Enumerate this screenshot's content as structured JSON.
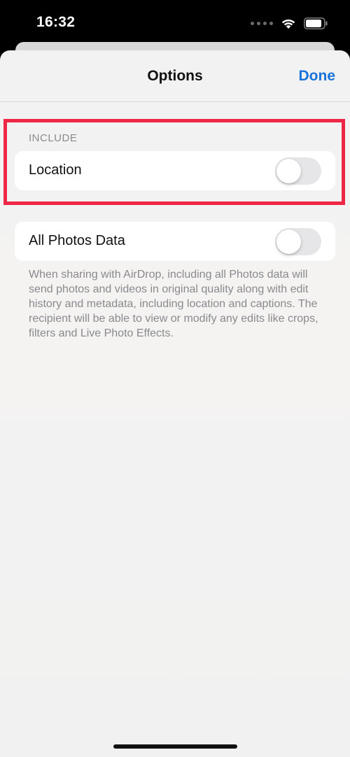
{
  "status_bar": {
    "time": "16:32"
  },
  "nav": {
    "title": "Options",
    "done_label": "Done"
  },
  "include_section": {
    "header": "INCLUDE",
    "location_label": "Location",
    "location_on": false
  },
  "all_photos": {
    "label": "All Photos Data",
    "enabled": false,
    "footer": "When sharing with AirDrop, including all Photos data will send photos and videos in original quality along with edit history and metadata, including location and captions. The recipient will be able to view or modify any edits like crops, filters and Live Photo Effects."
  },
  "colors": {
    "accent": "#1a73d9",
    "highlight": "#ee2747",
    "toggle_off": "#e6e6e8",
    "background": "#f2f2f2"
  },
  "icons": [
    "signal-icon",
    "wifi-icon",
    "battery-icon"
  ]
}
